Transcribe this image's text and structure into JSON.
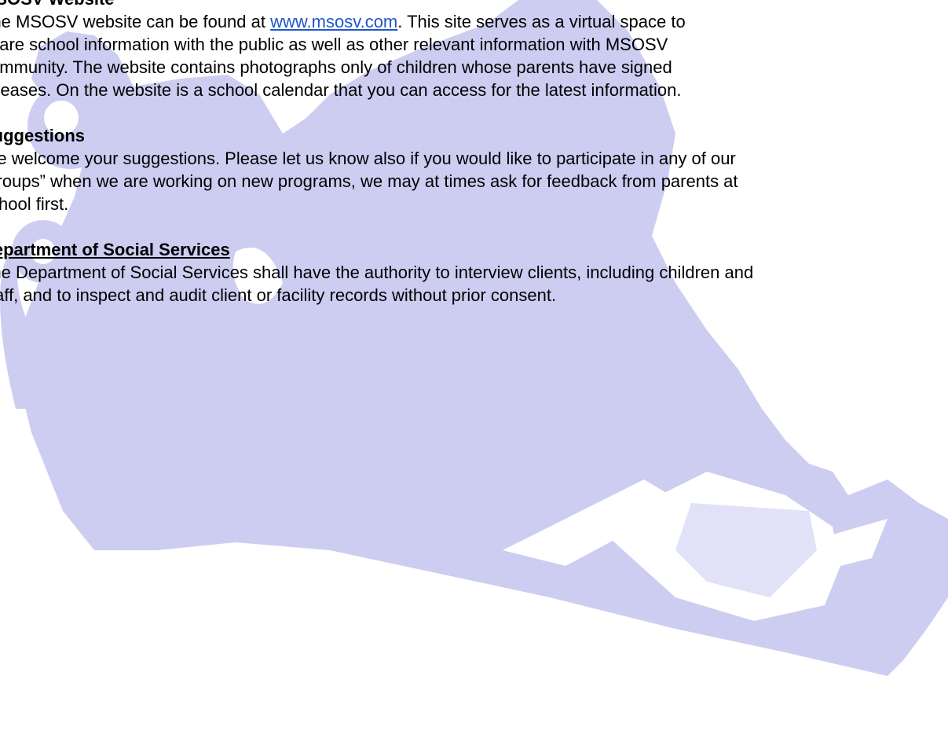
{
  "colors": {
    "watermark": "#cdcdf2",
    "link": "#1f56c9",
    "text": "#000000"
  },
  "watermark": {
    "icon": "child-playing-silhouette-icon"
  },
  "website_section": {
    "heading": "MSOSV Website",
    "line1_before_link": "The MSOSV website can be found at ",
    "link_text": "www.msosv.com",
    "line1_after_link": ". This site serves as a virtual space to",
    "line2": "share school information with the public as well as other relevant information with MSOSV",
    "line3": "community. The website contains photographs only of children whose parents have signed",
    "line4": "releases. On the website is a school calendar that you can access for the latest information."
  },
  "suggestions_section": {
    "heading": "Suggestions",
    "line1": "We welcome your suggestions. Please let us know also if you would like to participate in any of our",
    "line2": "“groups” when we are working on new programs, we may at times ask for feedback from parents at",
    "line3": "school first."
  },
  "dss_section": {
    "heading": "Department of Social Services",
    "line1": "The Department of Social Services shall have the authority to interview clients, including children and",
    "line2": "staff, and to inspect and audit client or facility records without prior consent."
  }
}
